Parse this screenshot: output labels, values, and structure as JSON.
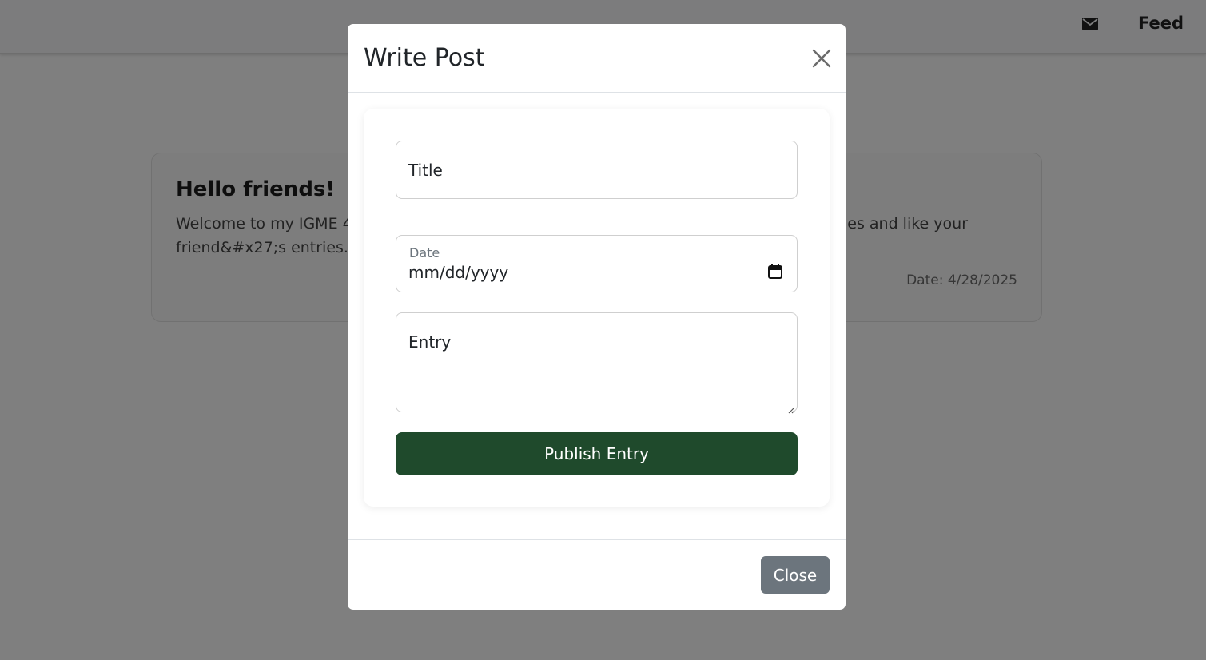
{
  "navbar": {
    "mail_icon": "envelope-icon",
    "feed_label": "Feed"
  },
  "post": {
    "title": "Hello friends!",
    "body": "Welcome to my IGME 430 project! This is a journal app where you can make, share entries and like your friend&#x27;s entries.",
    "date": "Date: 4/28/2025"
  },
  "modal": {
    "title": "Write Post",
    "close_icon": "close-icon",
    "title_placeholder": "Title",
    "date_label": "Date",
    "date_placeholder": "mm/dd/yyyy",
    "calendar_icon": "calendar-icon",
    "entry_placeholder": "Entry",
    "publish_label": "Publish Entry",
    "close_label": "Close"
  },
  "colors": {
    "publish_button": "#1f4a2c",
    "close_button": "#6c757d",
    "backdrop": "rgba(0,0,0,0.5)"
  }
}
